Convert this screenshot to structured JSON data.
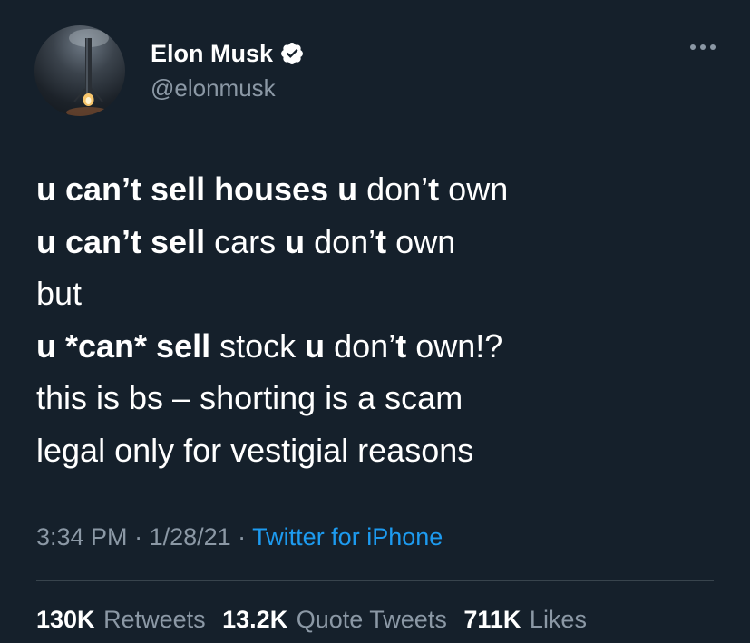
{
  "author": {
    "display_name": "Elon Musk",
    "handle": "@elonmusk",
    "verified_icon": "verified-badge-icon",
    "avatar_icon": "rocket-avatar"
  },
  "tweet": {
    "lines": [
      [
        {
          "t": "u can’t sell houses u",
          "b": true
        },
        {
          "t": " don’",
          "b": false
        },
        {
          "t": "t",
          "b": true
        },
        {
          "t": " own",
          "b": false
        }
      ],
      [
        {
          "t": "u can’t sell",
          "b": true
        },
        {
          "t": " cars ",
          "b": false
        },
        {
          "t": "u",
          "b": true
        },
        {
          "t": " don’",
          "b": false
        },
        {
          "t": "t",
          "b": true
        },
        {
          "t": " own",
          "b": false
        }
      ],
      [
        {
          "t": "but",
          "b": false
        }
      ],
      [
        {
          "t": "u *can* sell",
          "b": true
        },
        {
          "t": " stock ",
          "b": false
        },
        {
          "t": "u",
          "b": true
        },
        {
          "t": " don’",
          "b": false
        },
        {
          "t": "t",
          "b": true
        },
        {
          "t": " own!?",
          "b": false
        }
      ],
      [
        {
          "t": "this is bs – shorting is a scam",
          "b": false
        }
      ],
      [
        {
          "t": "legal only for vestigial reasons",
          "b": false
        }
      ]
    ]
  },
  "meta": {
    "time": "3:34 PM",
    "sep1": " · ",
    "date": "1/28/21",
    "sep2": " · ",
    "source": "Twitter for iPhone"
  },
  "stats": {
    "retweets_count": "130K",
    "retweets_label": "Retweets",
    "quotes_count": "13.2K",
    "quotes_label": "Quote Tweets",
    "likes_count": "711K",
    "likes_label": "Likes"
  },
  "colors": {
    "background": "#15202b",
    "text": "#ffffff",
    "secondary": "#8b98a5",
    "link": "#1d9bf0",
    "divider": "#38444d"
  }
}
